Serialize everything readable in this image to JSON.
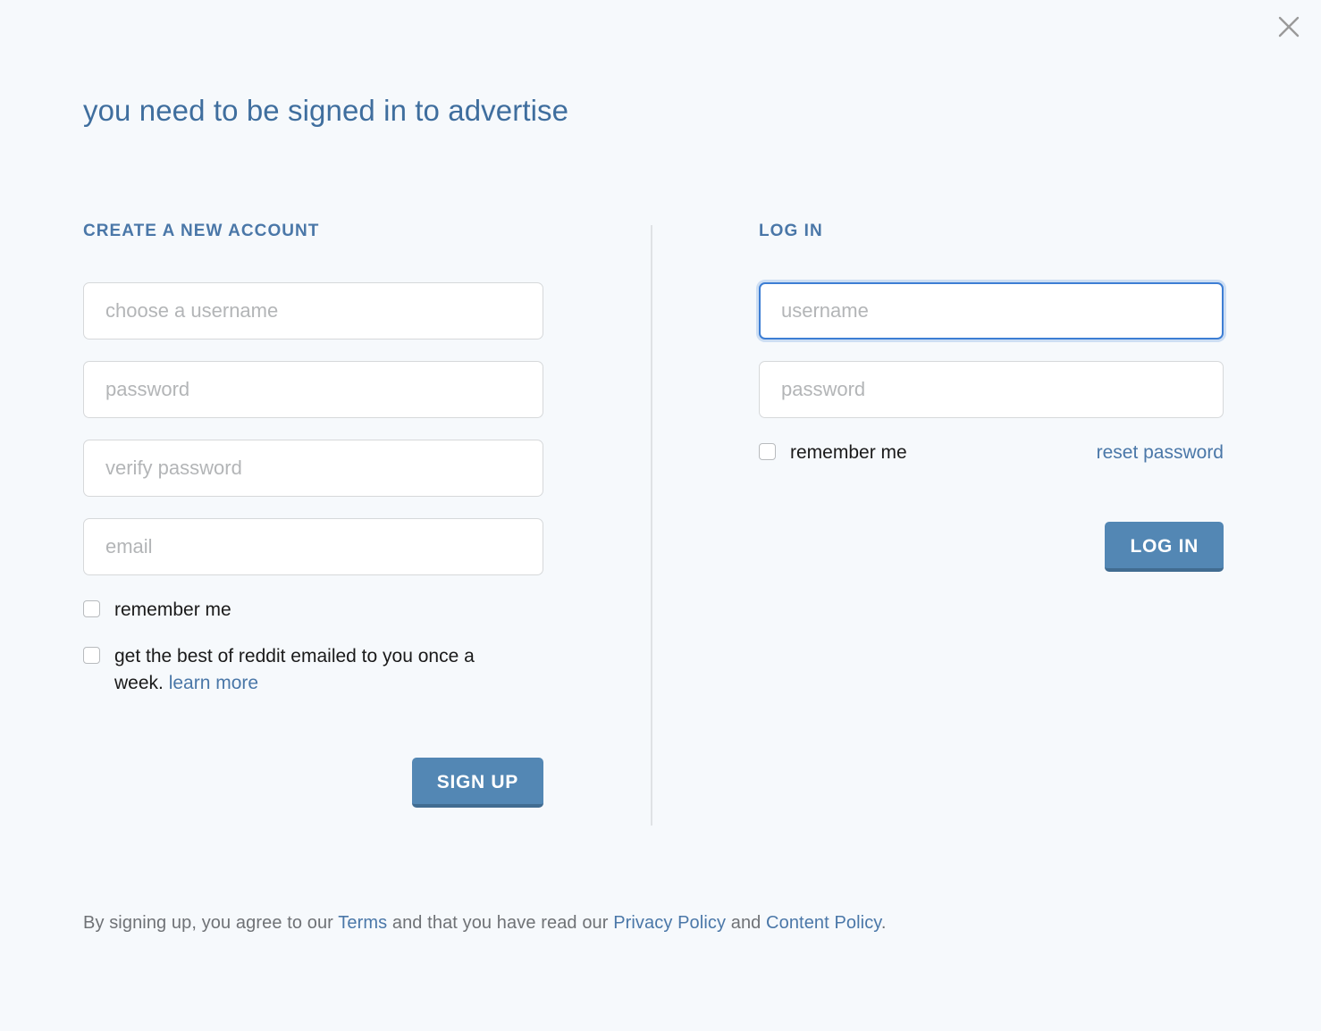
{
  "dialog": {
    "title": "you need to be signed in to advertise",
    "close_label": "×"
  },
  "signup": {
    "heading": "CREATE A NEW ACCOUNT",
    "fields": {
      "username_placeholder": "choose a username",
      "password_placeholder": "password",
      "verify_password_placeholder": "verify password",
      "email_placeholder": "email",
      "username_value": "",
      "password_value": "",
      "verify_password_value": "",
      "email_value": ""
    },
    "remember_me_label": "remember me",
    "newsletter_label": "get the best of reddit emailed to you once a week.",
    "learn_more_label": "learn more",
    "submit_label": "SIGN UP"
  },
  "login": {
    "heading": "LOG IN",
    "fields": {
      "username_placeholder": "username",
      "password_placeholder": "password",
      "username_value": "",
      "password_value": ""
    },
    "remember_me_label": "remember me",
    "reset_password_label": "reset password",
    "submit_label": "LOG IN"
  },
  "legal": {
    "prefix": "By signing up, you agree to our ",
    "terms_label": "Terms",
    "middle": " and that you have read our ",
    "privacy_label": "Privacy Policy",
    "conjunction": " and ",
    "content_policy_label": "Content Policy",
    "suffix": "."
  },
  "colors": {
    "background": "#f6f9fc",
    "heading": "#3f6e9e",
    "accent_link": "#4a77a8",
    "button": "#5387b4",
    "button_shadow": "#416c91",
    "focus_border": "#3d7ed4",
    "field_border": "#d6d8da",
    "divider": "#dfe2e5",
    "placeholder": "#b3b5b7",
    "legal_text": "#6f7276"
  }
}
